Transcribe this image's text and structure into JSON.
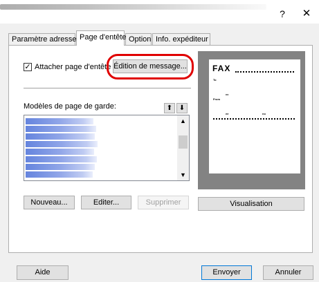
{
  "window": {
    "help_glyph": "?",
    "close_glyph": "✕"
  },
  "tabs": [
    {
      "label": "Paramètre adresse",
      "active": false
    },
    {
      "label": "Page d'entête",
      "active": true
    },
    {
      "label": "Option",
      "active": false
    },
    {
      "label": "Info. expéditeur",
      "active": false
    }
  ],
  "attach": {
    "checked": true,
    "check_glyph": "✓",
    "label": "Attacher page d'entête"
  },
  "edit_message_button": "Édition de message...",
  "templates": {
    "label": "Modèles de page de garde:",
    "move_up_glyph": "⬆",
    "move_down_glyph": "⬇"
  },
  "list": {
    "scroll_up_glyph": "▲",
    "scroll_down_glyph": "▼"
  },
  "actions": {
    "new": "Nouveau...",
    "edit": "Editer...",
    "delete": "Supprimer",
    "preview": "Visualisation"
  },
  "preview_page": {
    "title": "FAX",
    "to_label": "To",
    "cc_label": "cc",
    "from_label": "From",
    "date_label": "ee",
    "no_label": "no"
  },
  "footer": {
    "help": "Aide",
    "send": "Envoyer",
    "cancel": "Annuler"
  },
  "colors": {
    "highlight_ring": "#e00000",
    "preview_background": "#838383",
    "list_item_blur": "#4a6fd8"
  }
}
